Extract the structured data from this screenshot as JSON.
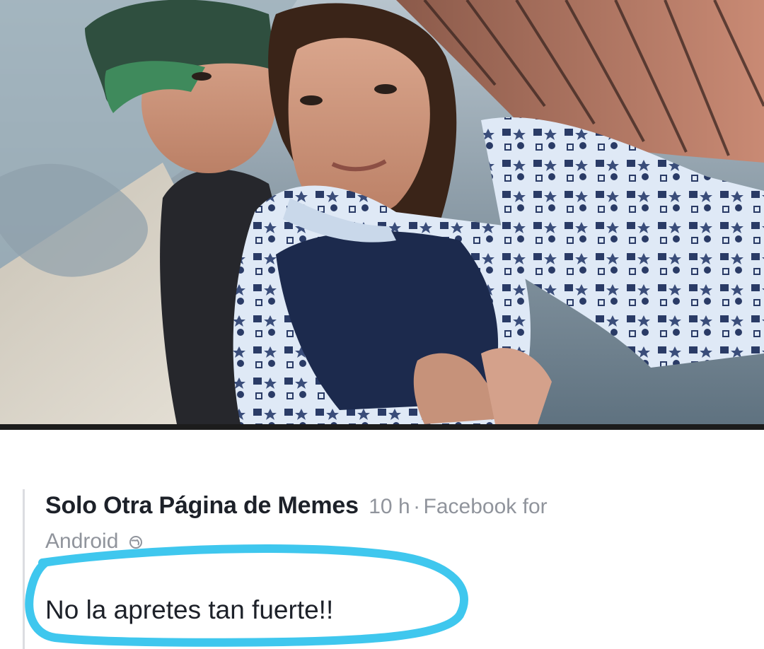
{
  "post": {
    "author": "Solo Otra Página de Memes",
    "time": "10 h",
    "separator": "·",
    "source_line1": "Facebook for",
    "source_line2": "Android",
    "message": "No la apretes tan fuerte!!"
  },
  "colors": {
    "author_text": "#1d2129",
    "meta_text": "#90949c",
    "highlight_stroke": "#3fc7ee",
    "photo_border": "#1c1c1c"
  },
  "icons": {
    "privacy": "globe-icon"
  }
}
